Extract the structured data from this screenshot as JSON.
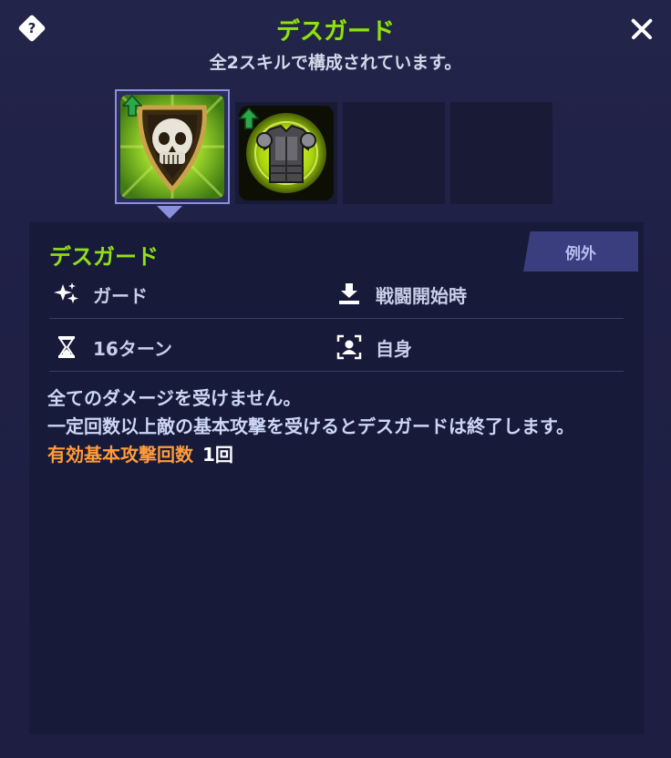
{
  "header": {
    "title": "デスガード",
    "subtitle": "全2スキルで構成されています。"
  },
  "skills": [
    {
      "icon": "skull-shield-icon",
      "upgrade": true,
      "selected": true
    },
    {
      "icon": "armor-icon",
      "upgrade": true,
      "selected": false
    },
    {
      "icon": "",
      "upgrade": false,
      "selected": false
    },
    {
      "icon": "",
      "upgrade": false,
      "selected": false
    }
  ],
  "detail": {
    "name": "デスガード",
    "tag": "例外",
    "type_label": "ガード",
    "timing_label": "戦闘開始時",
    "duration_label": "16ターン",
    "target_label": "自身",
    "description_line1": "全てのダメージを受けません。",
    "description_line2": "一定回数以上敵の基本攻撃を受けるとデスガードは終了します。",
    "effect_label": "有効基本攻撃回数",
    "effect_value": "1回"
  },
  "colors": {
    "accent_green": "#8fe016",
    "effect_orange": "#ff9b3a",
    "tag_bg": "#3a3d7e",
    "selected_border": "#8c8ee0"
  }
}
